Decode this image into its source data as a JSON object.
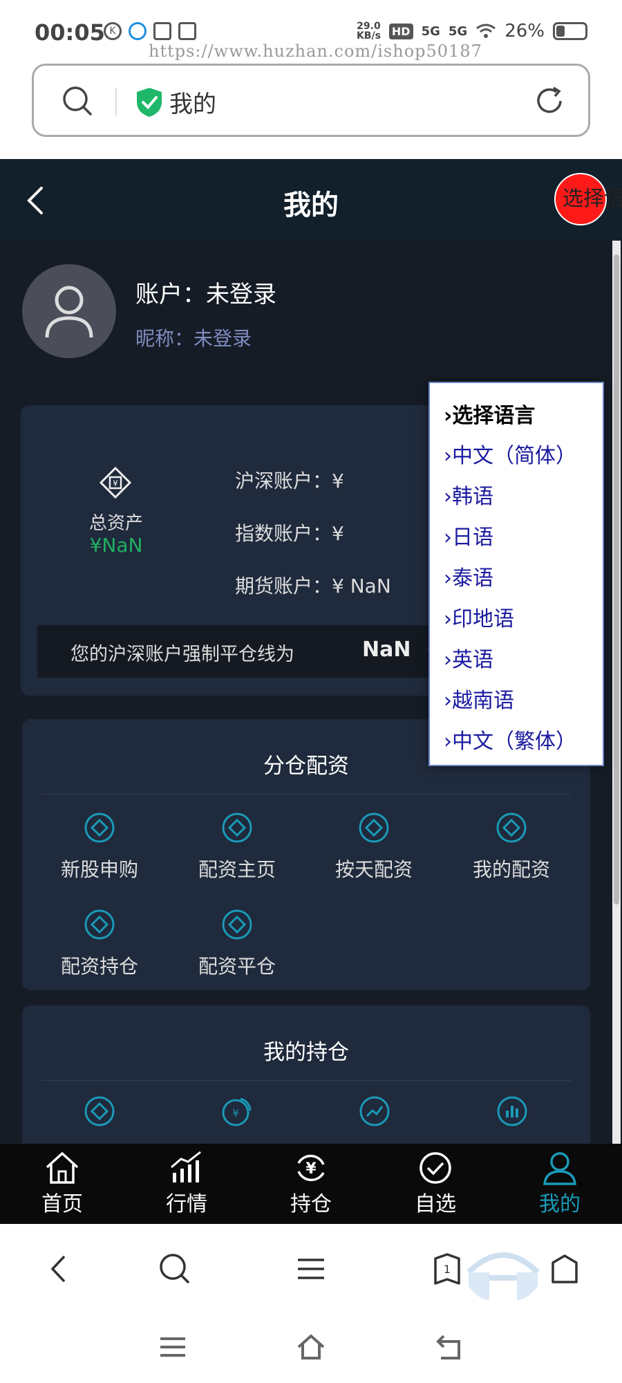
{
  "status_bar": {
    "time": "00:05",
    "speed_top": "29.0",
    "speed_bottom": "KB/s",
    "net1": "5G",
    "net2": "5G",
    "battery": "26%"
  },
  "watermark": "https://www.huzhan.com/ishop50187",
  "address_bar": {
    "title": "我的"
  },
  "header": {
    "title": "我的",
    "language_button": "选择语"
  },
  "profile": {
    "account": "账户：未登录",
    "nickname": "昵称：未登录"
  },
  "assets": {
    "total_label": "总资产",
    "total_value": "¥NaN",
    "rows": [
      "沪深账户：¥",
      "指数账户：¥",
      "期货账户：¥ NaN"
    ],
    "warning_text": "您的沪深账户强制平仓线为",
    "warning_value": "NaN"
  },
  "language_menu": {
    "header": "›选择语言",
    "items": [
      "›中文（简体）",
      "›韩语",
      "›日语",
      "›泰语",
      "›印地语",
      "›英语",
      "›越南语",
      "›中文（繁体）"
    ]
  },
  "allocation_card": {
    "title": "分仓配资",
    "items": [
      "新股申购",
      "配资主页",
      "按天配资",
      "我的配资",
      "配资持仓",
      "配资平仓"
    ]
  },
  "holdings_card": {
    "title": "我的持仓"
  },
  "tabs": [
    {
      "label": "首页"
    },
    {
      "label": "行情"
    },
    {
      "label": "持仓"
    },
    {
      "label": "自选"
    },
    {
      "label": "我的"
    }
  ],
  "colors": {
    "accent": "#1a9ab8",
    "positive": "#20b060",
    "language_button": "#ff1a1a",
    "app_background": "#161c26",
    "card_background": "#1f2a3c"
  }
}
